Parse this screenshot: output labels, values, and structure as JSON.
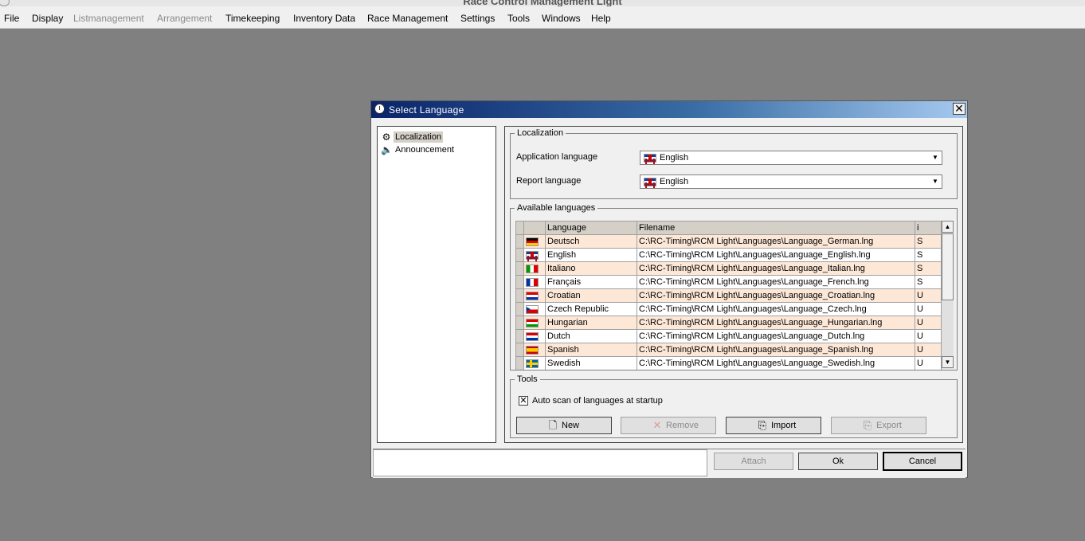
{
  "app": {
    "title": "Race Control Management Light"
  },
  "menu": [
    {
      "label": "File",
      "disabled": false
    },
    {
      "label": "Display",
      "disabled": false
    },
    {
      "label": "Listmanagement",
      "disabled": true
    },
    {
      "label": "Arrangement",
      "disabled": true
    },
    {
      "label": "Timekeeping",
      "disabled": false
    },
    {
      "label": "Inventory Data",
      "disabled": false
    },
    {
      "label": "Race Management",
      "disabled": false
    },
    {
      "label": "Settings",
      "disabled": false
    },
    {
      "label": "Tools",
      "disabled": false
    },
    {
      "label": "Windows",
      "disabled": false
    },
    {
      "label": "Help",
      "disabled": false
    }
  ],
  "dialog": {
    "title": "Select Language",
    "close_glyph": "✕",
    "nav": [
      {
        "label": "Localization",
        "icon": "localization-icon",
        "selected": true
      },
      {
        "label": "Announcement",
        "icon": "speaker-icon",
        "selected": false
      }
    ],
    "localization": {
      "legend": "Localization",
      "app_language_label": "Application language",
      "app_language_value": "English",
      "report_language_label": "Report language",
      "report_language_value": "English"
    },
    "available": {
      "legend": "Available languages",
      "columns": [
        "",
        "",
        "Language",
        "Filename",
        "i"
      ],
      "rows": [
        {
          "flag": "de",
          "language": "Deutsch",
          "filename": "C:\\RC-Timing\\RCM Light\\Languages\\Language_German.lng",
          "i": "S"
        },
        {
          "flag": "gb",
          "language": "English",
          "filename": "C:\\RC-Timing\\RCM Light\\Languages\\Language_English.lng",
          "i": "S"
        },
        {
          "flag": "it",
          "language": "Italiano",
          "filename": "C:\\RC-Timing\\RCM Light\\Languages\\Language_Italian.lng",
          "i": "S"
        },
        {
          "flag": "fr",
          "language": "Français",
          "filename": "C:\\RC-Timing\\RCM Light\\Languages\\Language_French.lng",
          "i": "S"
        },
        {
          "flag": "hr",
          "language": "Croatian",
          "filename": "C:\\RC-Timing\\RCM Light\\Languages\\Language_Croatian.lng",
          "i": "U"
        },
        {
          "flag": "cz",
          "language": "Czech Republic",
          "filename": "C:\\RC-Timing\\RCM Light\\Languages\\Language_Czech.lng",
          "i": "U"
        },
        {
          "flag": "hu",
          "language": "Hungarian",
          "filename": "C:\\RC-Timing\\RCM Light\\Languages\\Language_Hungarian.lng",
          "i": "U"
        },
        {
          "flag": "nl",
          "language": "Dutch",
          "filename": "C:\\RC-Timing\\RCM Light\\Languages\\Language_Dutch.lng",
          "i": "U"
        },
        {
          "flag": "es",
          "language": "Spanish",
          "filename": "C:\\RC-Timing\\RCM Light\\Languages\\Language_Spanish.lng",
          "i": "U"
        },
        {
          "flag": "se",
          "language": "Swedish",
          "filename": "C:\\RC-Timing\\RCM Light\\Languages\\Language_Swedish.lng",
          "i": "U"
        }
      ]
    },
    "tools": {
      "legend": "Tools",
      "autoscan_checked": true,
      "autoscan_label": "Auto scan of languages at startup",
      "buttons": [
        {
          "label": "New",
          "icon": "new-document-icon",
          "glyph": "🗋",
          "disabled": false
        },
        {
          "label": "Remove",
          "icon": "remove-icon",
          "glyph": "✕",
          "disabled": true
        },
        {
          "label": "Import",
          "icon": "import-icon",
          "glyph": "⎘",
          "disabled": false
        },
        {
          "label": "Export",
          "icon": "export-icon",
          "glyph": "⎘",
          "disabled": true
        }
      ]
    },
    "footer": {
      "attach_label": "Attach",
      "ok_label": "Ok",
      "cancel_label": "Cancel"
    }
  }
}
